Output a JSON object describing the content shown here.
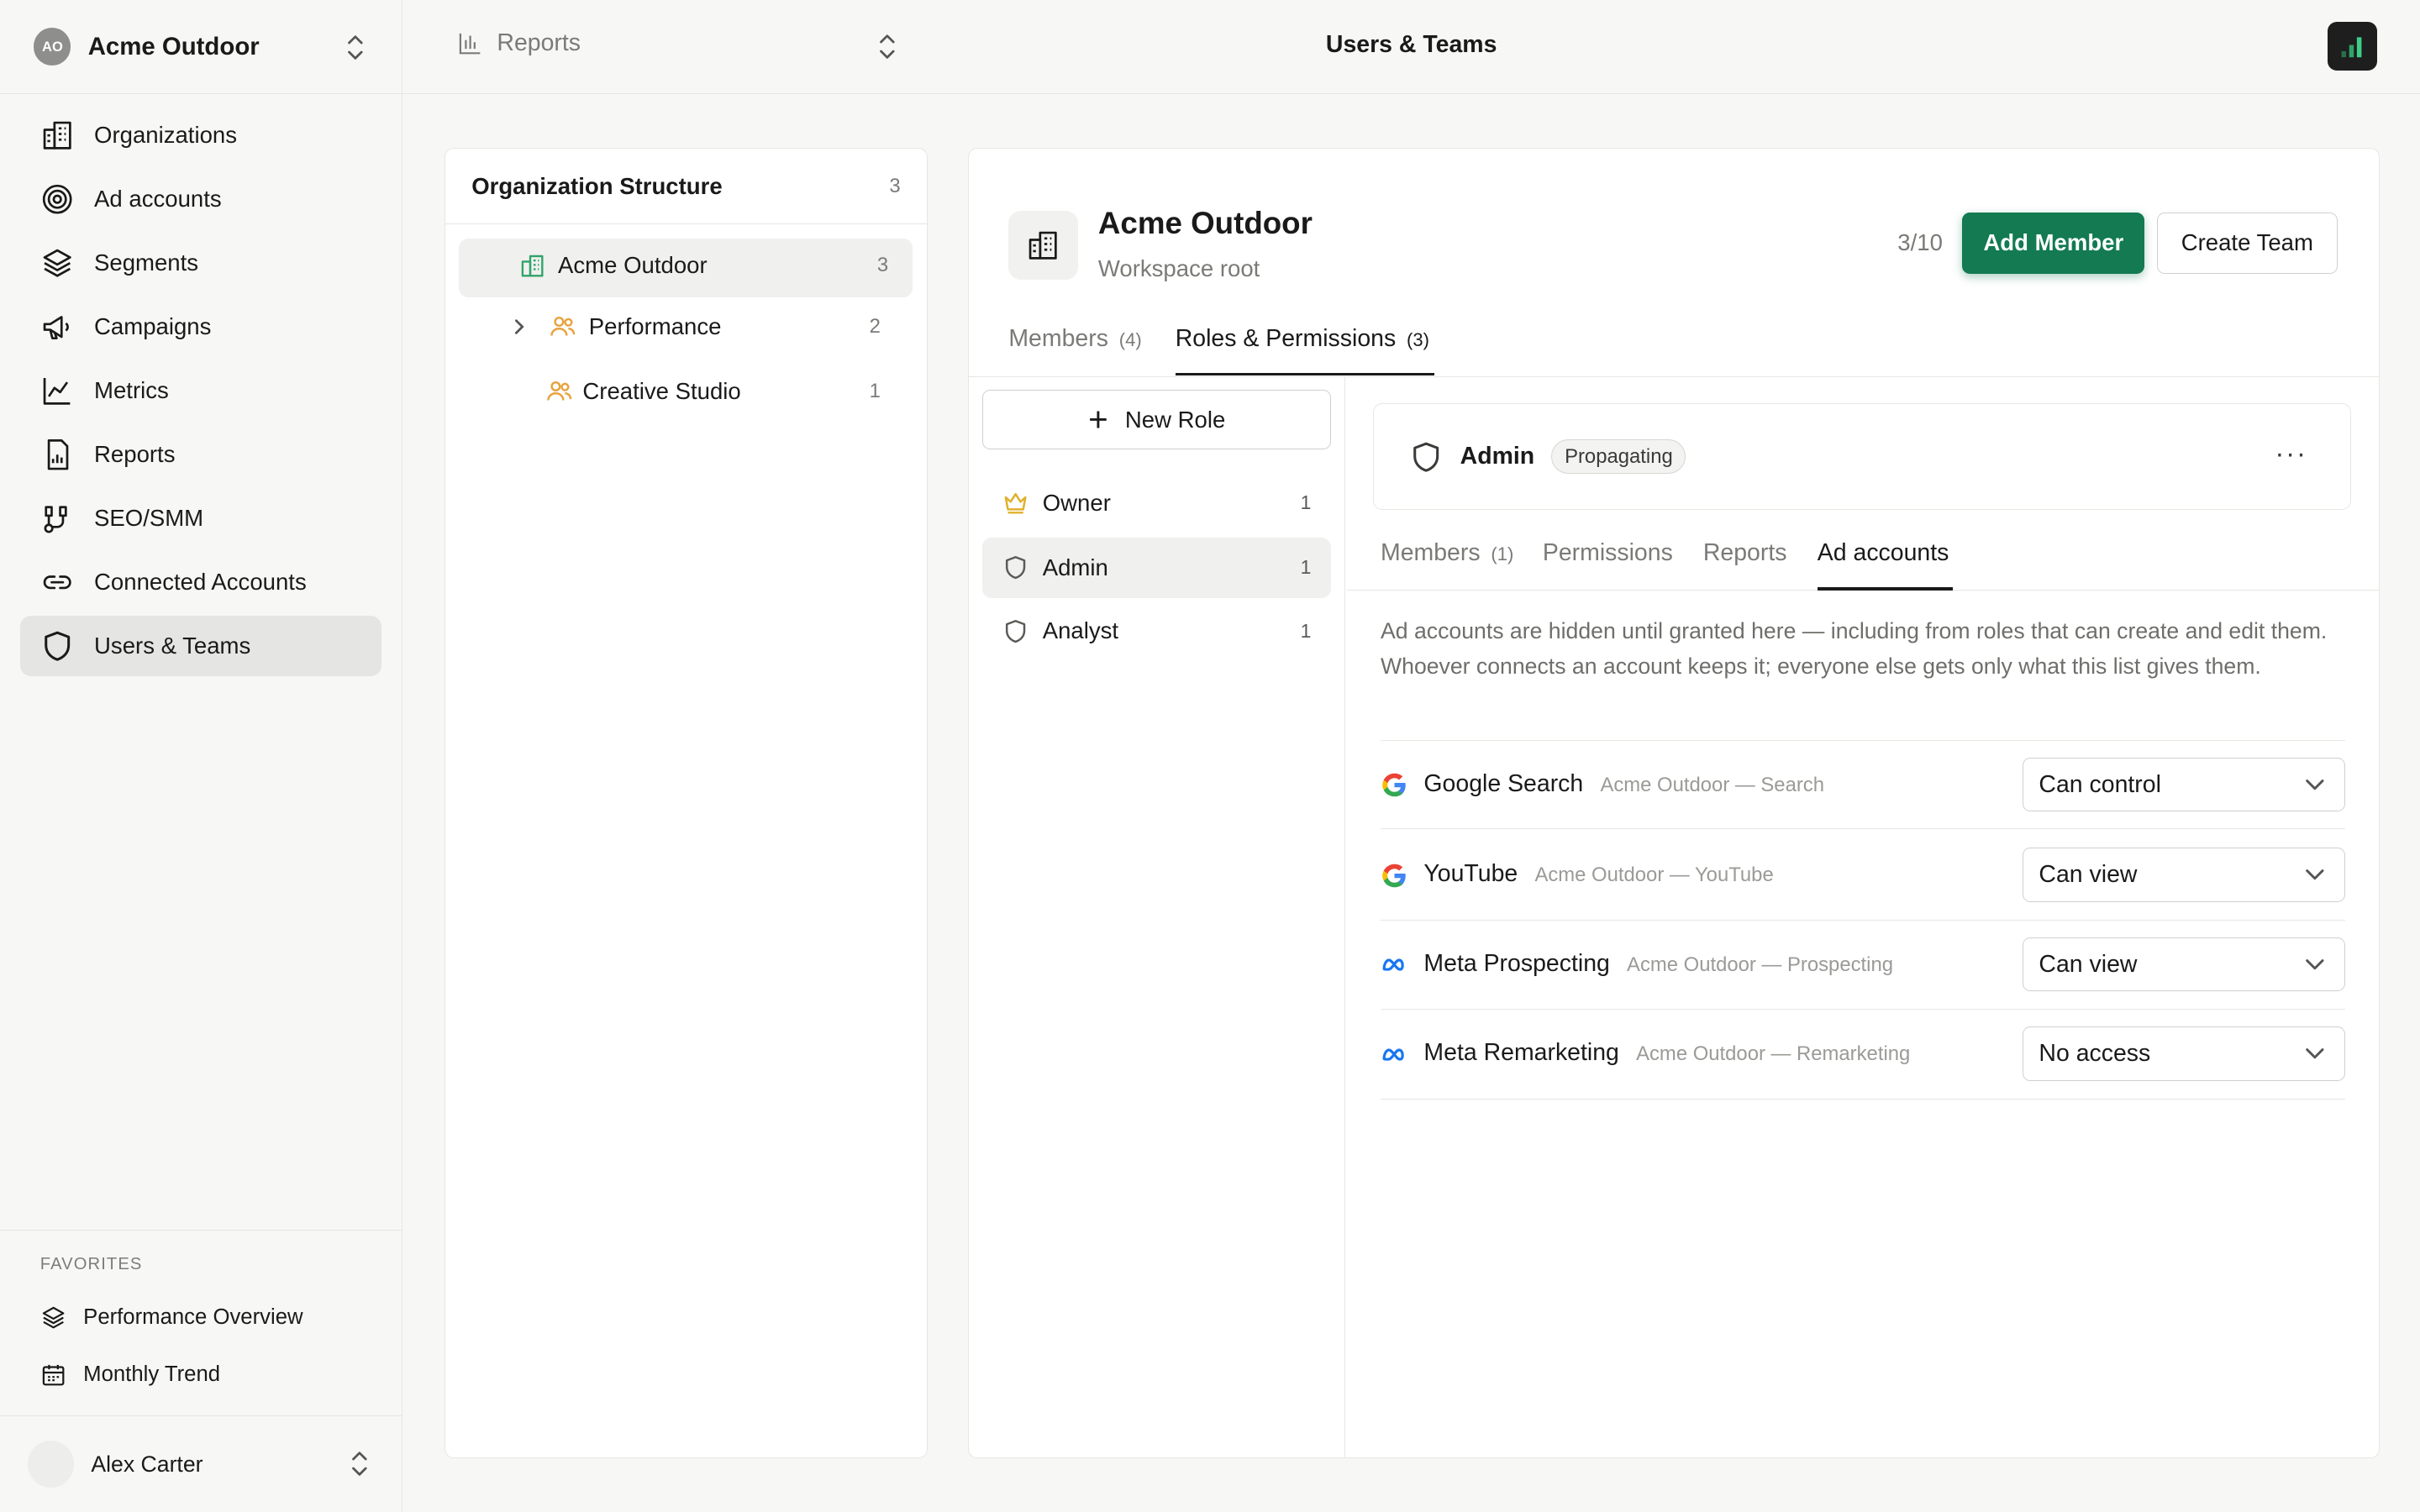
{
  "sidebar": {
    "org": {
      "initials": "AO",
      "name": "Acme Outdoor"
    },
    "items": [
      {
        "label": "Organizations",
        "icon": "building-icon"
      },
      {
        "label": "Ad accounts",
        "icon": "target-icon"
      },
      {
        "label": "Segments",
        "icon": "layers-icon"
      },
      {
        "label": "Campaigns",
        "icon": "megaphone-icon"
      },
      {
        "label": "Metrics",
        "icon": "line-chart-icon"
      },
      {
        "label": "Reports",
        "icon": "report-icon"
      },
      {
        "label": "SEO/SMM",
        "icon": "route-icon"
      },
      {
        "label": "Connected Accounts",
        "icon": "link-icon"
      },
      {
        "label": "Users & Teams",
        "icon": "shield-icon",
        "active": true
      }
    ],
    "favorites_title": "FAVORITES",
    "favorites": [
      {
        "label": "Performance Overview",
        "icon": "layers-icon"
      },
      {
        "label": "Monthly Trend",
        "icon": "calendar-icon"
      }
    ],
    "user": {
      "name": "Alex Carter"
    }
  },
  "topbar": {
    "report_switch": "Reports",
    "title": "Users & Teams"
  },
  "org_structure": {
    "title": "Organization Structure",
    "count": "3",
    "items": [
      {
        "label": "Acme Outdoor",
        "count": "3"
      },
      {
        "label": "Performance",
        "count": "2"
      },
      {
        "label": "Creative Studio",
        "count": "1"
      }
    ]
  },
  "workspace": {
    "title": "Acme Outdoor",
    "subtitle": "Workspace root",
    "quota": "3/10",
    "add_member": "Add Member",
    "create_team": "Create Team",
    "tabs": [
      {
        "label": "Members",
        "count": "(4)"
      },
      {
        "label": "Roles & Permissions",
        "count": "(3)",
        "active": true
      }
    ]
  },
  "roles": {
    "new_role": "New Role",
    "items": [
      {
        "label": "Owner",
        "count": "1",
        "icon": "crown-icon"
      },
      {
        "label": "Admin",
        "count": "1",
        "icon": "shield-icon",
        "active": true
      },
      {
        "label": "Analyst",
        "count": "1",
        "icon": "shield-icon"
      }
    ]
  },
  "role_detail": {
    "name": "Admin",
    "badge": "Propagating",
    "more": "···",
    "subtabs": [
      {
        "label": "Members",
        "count": "(1)"
      },
      {
        "label": "Permissions",
        "count": ""
      },
      {
        "label": "Reports",
        "count": ""
      },
      {
        "label": "Ad accounts",
        "count": "",
        "active": true
      }
    ],
    "description": "Ad accounts are hidden until granted here — including from roles that can create and edit them. Whoever connects an account keeps it; everyone else gets only what this list gives them.",
    "accounts": [
      {
        "name": "Google Search",
        "sub": "Acme Outdoor — Search",
        "access": "Can control",
        "platform": "google-icon"
      },
      {
        "name": "YouTube",
        "sub": "Acme Outdoor — YouTube",
        "access": "Can view",
        "platform": "google-icon"
      },
      {
        "name": "Meta Prospecting",
        "sub": "Acme Outdoor — Prospecting",
        "access": "Can view",
        "platform": "meta-icon"
      },
      {
        "name": "Meta Remarketing",
        "sub": "Acme Outdoor — Remarketing",
        "access": "No access",
        "platform": "meta-icon"
      }
    ]
  },
  "colors": {
    "accent": "#137a52",
    "team_icon": "#e8a33d",
    "org_icon": "#2fa36b",
    "crown": "#e0b02a",
    "meta_blue": "#1877f2"
  }
}
